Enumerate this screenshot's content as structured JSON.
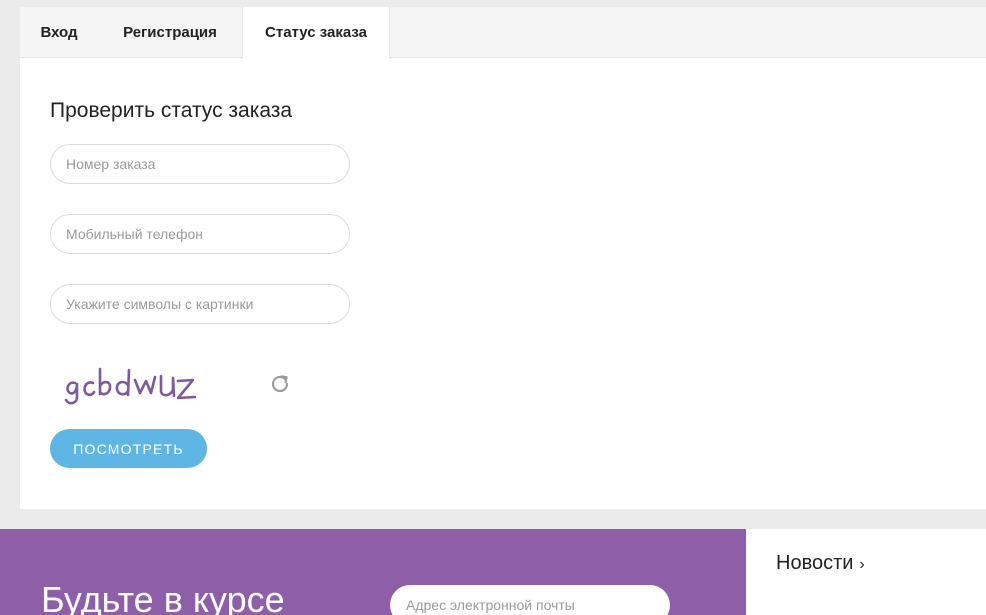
{
  "tabs": {
    "login": "Вход",
    "register": "Регистрация",
    "order_status": "Статус заказа"
  },
  "form": {
    "title": "Проверить статус заказа",
    "order_number_placeholder": "Номер заказа",
    "phone_placeholder": "Мобильный телефон",
    "captcha_placeholder": "Укажите символы с картинки",
    "captcha_text": "gcbdwuz",
    "refresh_icon": "refresh-icon",
    "submit_label": "ПОСМОТРЕТЬ"
  },
  "newsletter": {
    "title": "Будьте в курсе",
    "email_placeholder": "Адрес электронной почты"
  },
  "news": {
    "label": "Новости",
    "chevron": "›"
  },
  "colors": {
    "accent_button": "#5fb6e4",
    "promo_background": "#8e5fa8",
    "captcha_ink": "#7d5a9c"
  }
}
